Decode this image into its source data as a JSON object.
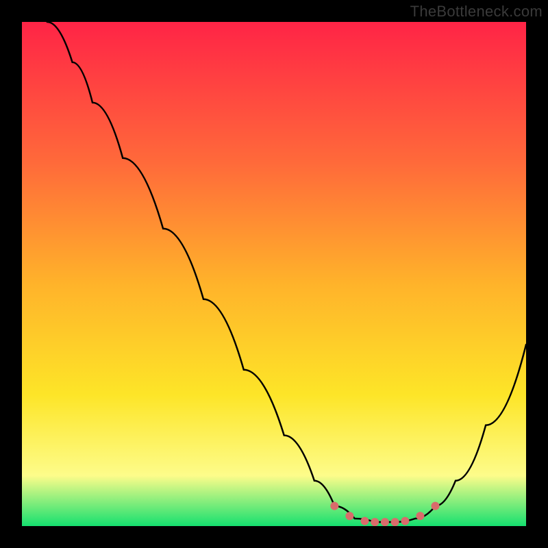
{
  "watermark": "TheBottleneck.com",
  "colors": {
    "gradient_top": "#ff2446",
    "gradient_upper": "#ff6a3a",
    "gradient_mid": "#ffb32a",
    "gradient_lower": "#fde528",
    "gradient_light": "#fdfc8a",
    "gradient_green": "#15e06f",
    "curve_stroke": "#000000",
    "marker_fill": "#d96b6b",
    "background": "#000000"
  },
  "chart_data": {
    "type": "line",
    "title": "",
    "xlabel": "",
    "ylabel": "",
    "xlim": [
      0,
      100
    ],
    "ylim": [
      0,
      100
    ],
    "curve": [
      {
        "x": 5,
        "y": 100
      },
      {
        "x": 10,
        "y": 92
      },
      {
        "x": 14,
        "y": 84
      },
      {
        "x": 20,
        "y": 73
      },
      {
        "x": 28,
        "y": 59
      },
      {
        "x": 36,
        "y": 45
      },
      {
        "x": 44,
        "y": 31
      },
      {
        "x": 52,
        "y": 18
      },
      {
        "x": 58,
        "y": 9
      },
      {
        "x": 62,
        "y": 4
      },
      {
        "x": 66,
        "y": 1.5
      },
      {
        "x": 70,
        "y": 0.8
      },
      {
        "x": 74,
        "y": 0.8
      },
      {
        "x": 78,
        "y": 1.5
      },
      {
        "x": 82,
        "y": 4
      },
      {
        "x": 86,
        "y": 9
      },
      {
        "x": 92,
        "y": 20
      },
      {
        "x": 100,
        "y": 36
      }
    ],
    "markers": [
      {
        "x": 62,
        "y": 4
      },
      {
        "x": 65,
        "y": 2
      },
      {
        "x": 68,
        "y": 1
      },
      {
        "x": 70,
        "y": 0.8
      },
      {
        "x": 72,
        "y": 0.8
      },
      {
        "x": 74,
        "y": 0.8
      },
      {
        "x": 76,
        "y": 1
      },
      {
        "x": 79,
        "y": 2
      },
      {
        "x": 82,
        "y": 4
      }
    ]
  }
}
